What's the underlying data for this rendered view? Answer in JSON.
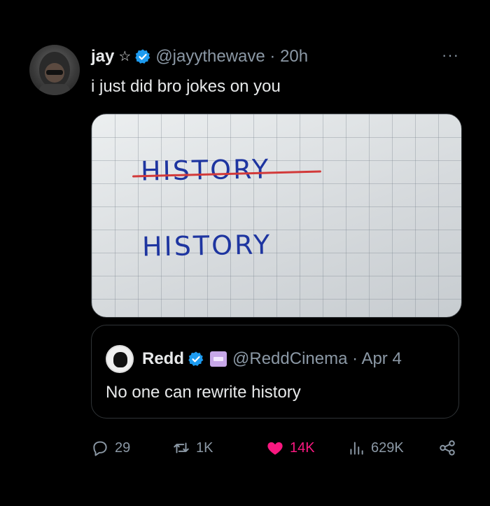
{
  "tweet": {
    "author_name": "jay",
    "star_glyph": "☆",
    "handle_time": "@jayythewave · 20h",
    "more": "···",
    "text": "i just did bro jokes on you",
    "image_words": {
      "crossed": "HISTORY",
      "rewritten": "HISTORY"
    }
  },
  "quoted": {
    "name": "Redd",
    "handle_time": "@ReddCinema · Apr 4",
    "text": "No one can rewrite history"
  },
  "actions": {
    "replies": "29",
    "reposts": "1K",
    "likes": "14K",
    "views": "629K"
  },
  "colors": {
    "background": "#000000",
    "verified": "#1d9bf0",
    "like": "#f91880",
    "secondary_text": "#8b98a5"
  },
  "icons": [
    "reply-icon",
    "repost-icon",
    "heart-icon",
    "views-icon",
    "share-icon",
    "verified-badge-icon",
    "more-icon"
  ]
}
